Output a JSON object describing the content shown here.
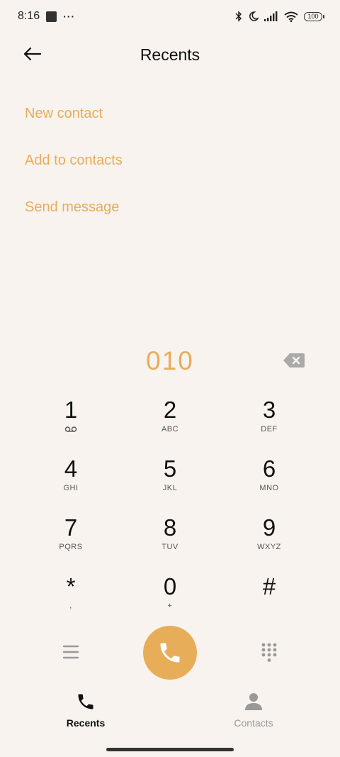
{
  "status_bar": {
    "time": "8:16",
    "more_indicator": "···",
    "battery": "100",
    "icons": [
      "bluetooth-icon",
      "moon-icon",
      "signal-icon",
      "wifi-icon",
      "battery-icon"
    ]
  },
  "header": {
    "title": "Recents",
    "back_icon": "arrow-left-icon"
  },
  "actions": [
    {
      "label": "New contact"
    },
    {
      "label": "Add to contacts"
    },
    {
      "label": "Send message"
    }
  ],
  "dialer": {
    "number": "010",
    "backspace_icon": "backspace-icon",
    "keys": [
      {
        "digit": "1",
        "letters": ""
      },
      {
        "digit": "2",
        "letters": "ABC"
      },
      {
        "digit": "3",
        "letters": "DEF"
      },
      {
        "digit": "4",
        "letters": "GHI"
      },
      {
        "digit": "5",
        "letters": "JKL"
      },
      {
        "digit": "6",
        "letters": "MNO"
      },
      {
        "digit": "7",
        "letters": "PQRS"
      },
      {
        "digit": "8",
        "letters": "TUV"
      },
      {
        "digit": "9",
        "letters": "WXYZ"
      },
      {
        "digit": "*",
        "letters": ","
      },
      {
        "digit": "0",
        "letters": "+"
      },
      {
        "digit": "#",
        "letters": ""
      }
    ]
  },
  "controls": {
    "menu_icon": "menu-icon",
    "call_icon": "phone-icon",
    "dialpad_icon": "dialpad-icon"
  },
  "bottom_nav": [
    {
      "label": "Recents",
      "icon": "phone-icon",
      "active": true
    },
    {
      "label": "Contacts",
      "icon": "person-icon",
      "active": false
    }
  ],
  "colors": {
    "accent": "#e8ad59",
    "background": "#f8f3ee",
    "text": "#111111",
    "inactive": "#999999"
  }
}
